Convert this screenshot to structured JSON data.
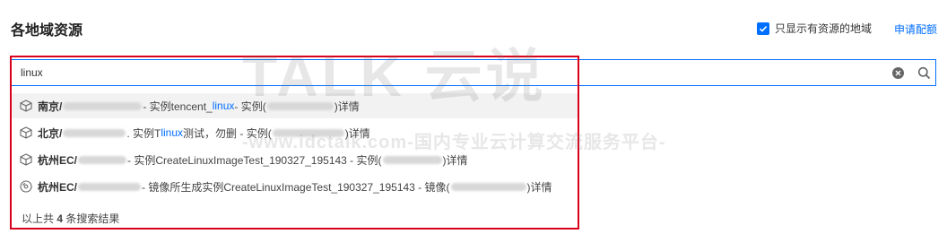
{
  "header": {
    "title": "各地域资源",
    "filter_label": "只显示有资源的地域",
    "apply_label": "申请配额"
  },
  "search": {
    "value": "linux"
  },
  "results": [
    {
      "region": "南京/",
      "mid1": " - 实例tencent_",
      "kw": "linux",
      "mid2": " - 实例(",
      "end": ")详情"
    },
    {
      "region": "北京/",
      "mid1": " . 实例T",
      "kw": "linux",
      "mid2": "测试，勿删 - 实例(",
      "end": ")详情"
    },
    {
      "region": "杭州EC/",
      "mid1": " - 实例CreateLinuxImageTest_190327_195143 - 实例(",
      "kw": "",
      "mid2": "",
      "end": ")详情"
    },
    {
      "region": "杭州EC/",
      "mid1": " - 镜像所生成实例CreateLinuxImageTest_190327_195143 - 镜像(",
      "kw": "",
      "mid2": "",
      "end": ")详情"
    }
  ],
  "summary": {
    "prefix": "以上共 ",
    "count": "4",
    "suffix": " 条搜索结果"
  },
  "watermark": {
    "logo": "TALK 云说",
    "url": "-www.idctalk.com-国内专业云计算交流服务平台-"
  },
  "icons": {
    "checkbox": "checkbox-checked-icon",
    "clear": "clear-icon",
    "search": "search-icon",
    "instance": "cube-icon",
    "image": "disc-icon"
  },
  "colors": {
    "accent": "#006eff",
    "highlight_frame": "#d9001b"
  }
}
